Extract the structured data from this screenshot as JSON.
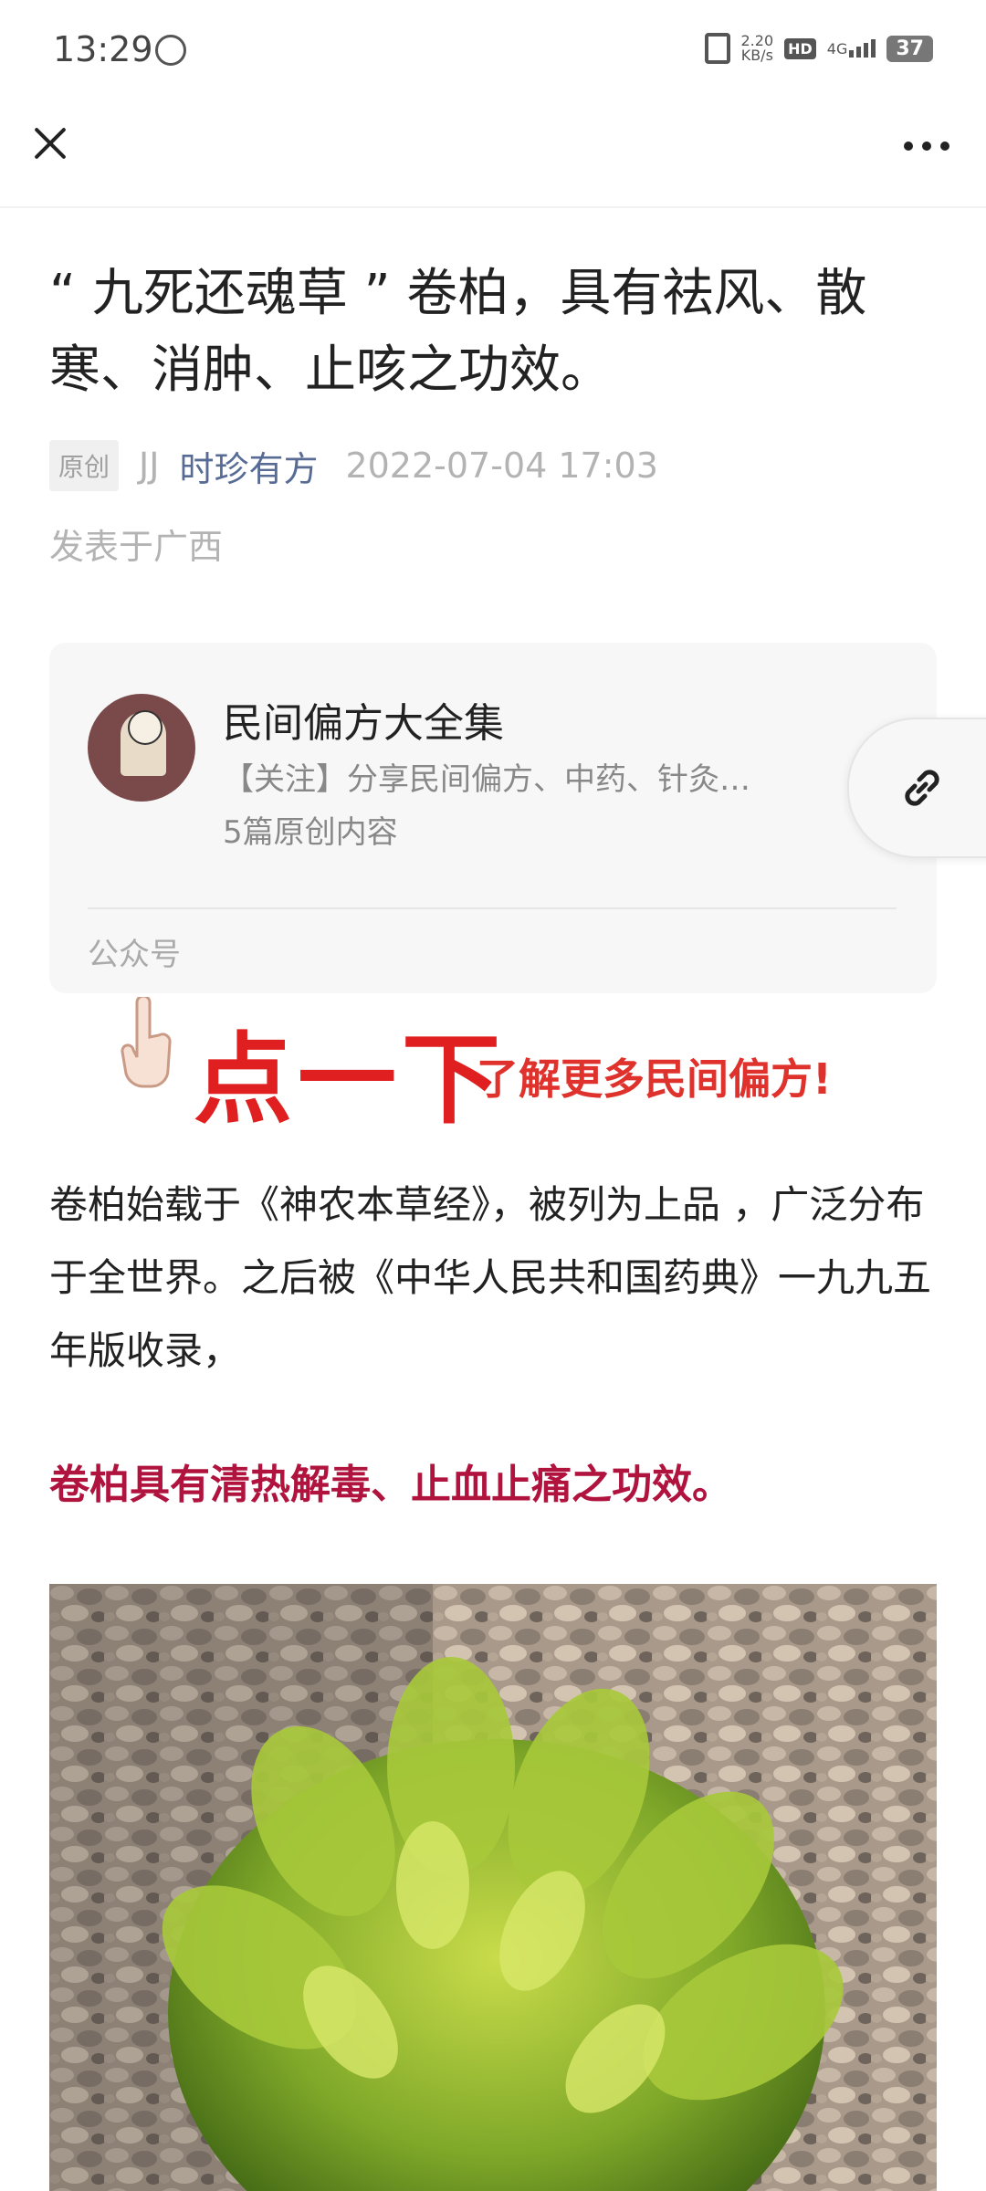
{
  "status": {
    "time": "13:29",
    "speed_value": "2.20",
    "speed_unit": "KB/s",
    "hd": "HD",
    "network": "4G",
    "battery": "37"
  },
  "article": {
    "title": "“ 九死还魂草 ” 卷柏，具有祛风、散寒、消肿、止咳之功效。",
    "original_tag": "原创",
    "author": "JJ",
    "account": "时珍有方",
    "datetime": "2022-07-04 17:03",
    "location": "发表于广西"
  },
  "card": {
    "name": "民间偏方大全集",
    "description": "【关注】分享民间偏方、中药、针灸…",
    "count": "5篇原创内容",
    "type": "公众号"
  },
  "promo": {
    "big": "点一下",
    "small": "了解更多民间偏方!"
  },
  "body": {
    "paragraph": "卷柏始载于《神农本草经》，被列为上品 ，广泛分布于全世界。之后被《中华人民共和国药典》一九九五年版收录，",
    "highlight": "卷柏具有清热解毒、止血止痛之功效。"
  },
  "colors": {
    "link": "#576b95",
    "promo_red": "#e02020",
    "highlight": "#b0133e"
  }
}
